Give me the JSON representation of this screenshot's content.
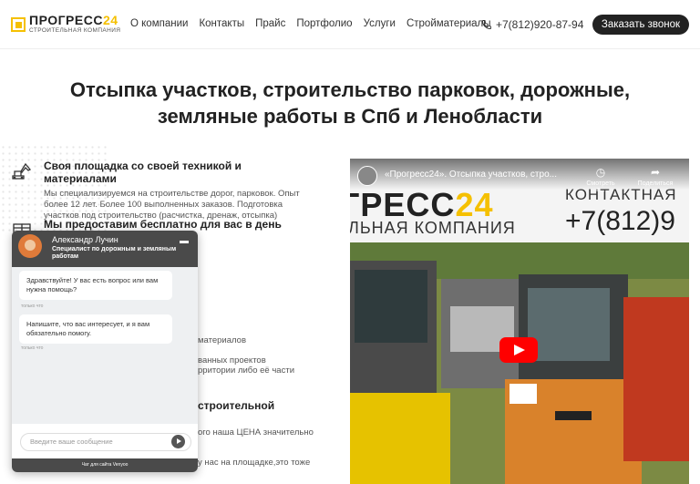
{
  "header": {
    "logo_name_main": "ПРОГРЕСС",
    "logo_name_accent": "24",
    "logo_sub": "СТРОИТЕЛЬНАЯ КОМПАНИЯ",
    "nav": [
      "О компании",
      "Контакты",
      "Прайс",
      "Портфолио",
      "Услуги",
      "Стройматериалы"
    ],
    "phone": "+7(812)920-87-94",
    "call_button": "Заказать звонок"
  },
  "hero": {
    "title": "Отсыпка участков, строительство парковок, дорожные, земляные работы в Спб и Ленобласти"
  },
  "features": [
    {
      "title": "Своя площадка со своей техникой и материалами",
      "text": "Мы специализируемся на строительстве дорог, парковок. Опыт более 12 лет. Более 100 выполненных заказов. Подготовка участков под строительство (расчистка, дренаж, отсыпка)"
    },
    {
      "title": "Мы предоставим бесплатно для вас в день"
    }
  ],
  "partial_text": {
    "t1": "материалов",
    "t2": "ванных проектов",
    "t3": "рритории либо её части",
    "t4": "строительной",
    "t5": "ого наша ЦЕНА значительно",
    "t6": "у нас на площадке,это тоже"
  },
  "video": {
    "title": "«Прогресс24». Отсыпка участков, стро...",
    "action_watch_later": "Смотреть п...",
    "action_share": "Поделиться",
    "brand_main": "ГРЕСС",
    "brand_accent": "24",
    "brand_sub": "ЛЬНАЯ КОМПАНИЯ",
    "contact_label": "КОНТАКТНАЯ",
    "contact_phone": "+7(812)9"
  },
  "chat": {
    "name": "Александр Лучин",
    "role": "Специалист по дорожным и земляным работам",
    "messages": [
      {
        "text": "Здравствуйте! У вас есть вопрос или вам нужна помощь?",
        "time": "только что"
      },
      {
        "text": "Напишите, что вас интересует, и я вам обязательно помогу.",
        "time": "только что"
      }
    ],
    "input_placeholder": "Введите ваше сообщение",
    "footer": "Чат для сайта Venyoo"
  },
  "colors": {
    "accent": "#f5c000",
    "dark": "#222222",
    "chat_header": "#4a4a4a",
    "play": "#ff0000"
  }
}
